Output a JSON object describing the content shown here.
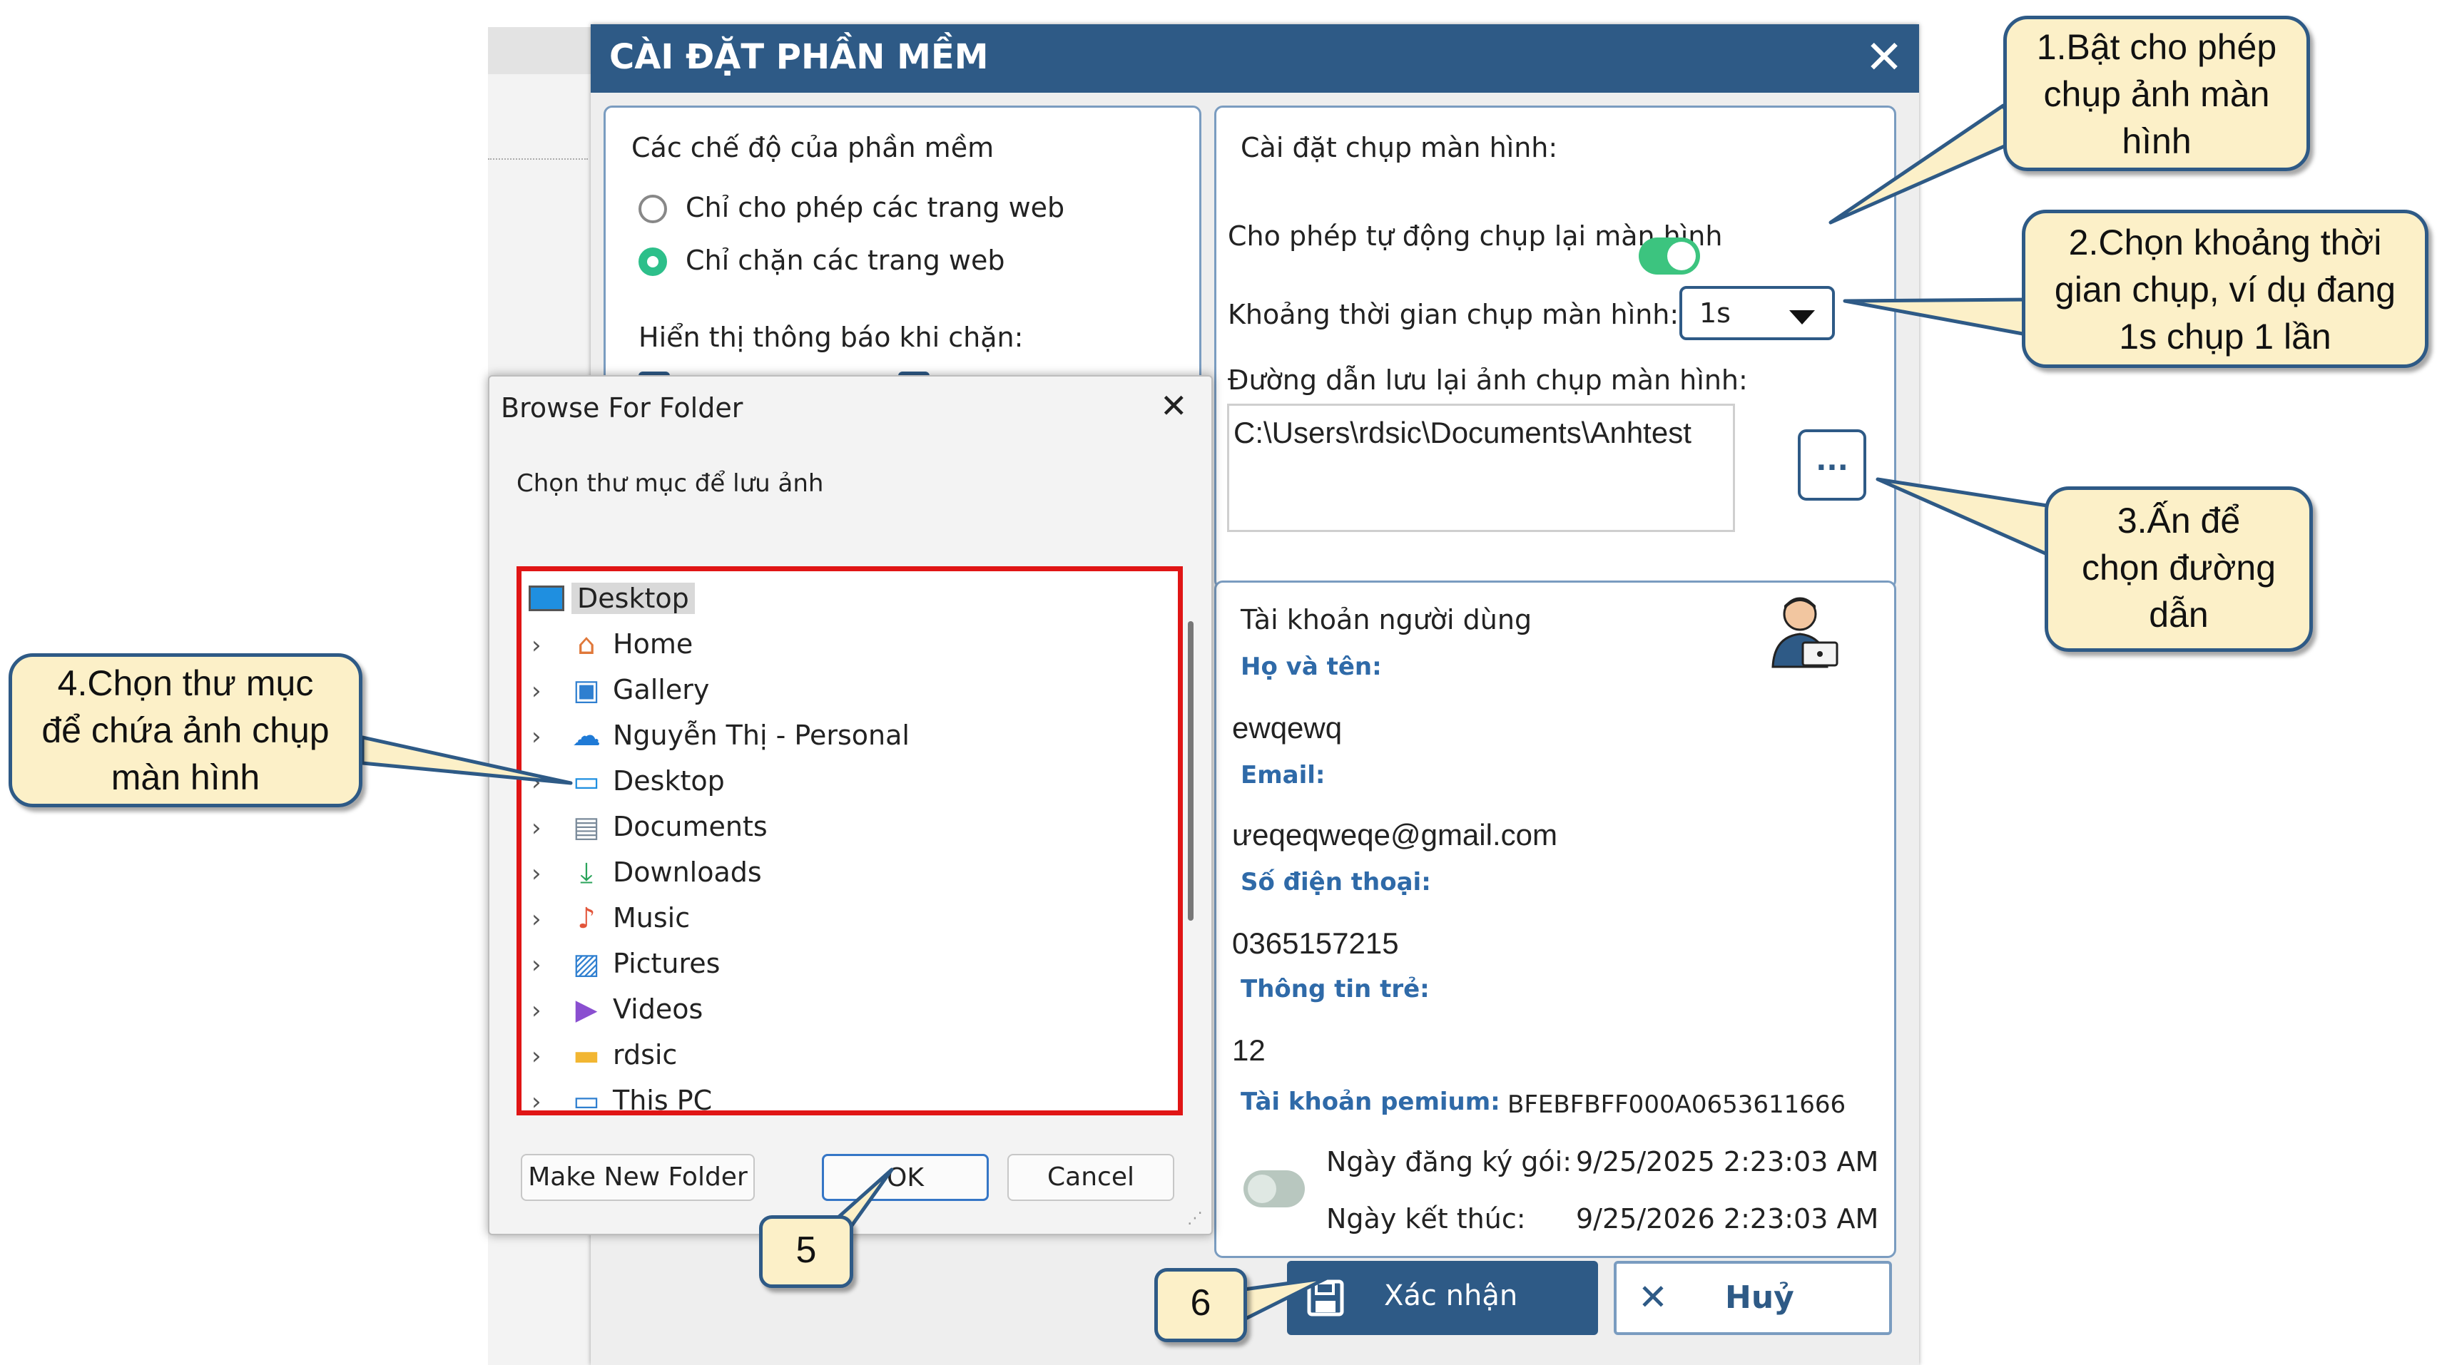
{
  "settings_dialog": {
    "title": "CÀI ĐẶT PHẦN MỀM",
    "close_glyph": "✕",
    "modes": {
      "heading": "Các chế độ của phần mềm",
      "options": [
        {
          "label": "Chỉ cho phép các trang web",
          "selected": false
        },
        {
          "label": "Chỉ chặn các trang web",
          "selected": true
        }
      ],
      "notify_heading": "Hiển thị thông báo khi chặn:"
    },
    "capture": {
      "heading": "Cài đặt chụp màn hình:",
      "auto_capture_label": "Cho phép tự động chụp lại màn hình",
      "auto_capture_enabled": true,
      "interval_label": "Khoảng thời gian chụp màn hình:",
      "interval_value": "1s",
      "path_label": "Đường dẫn lưu lại ảnh chụp màn hình:",
      "path_value": "C:\\Users\\rdsic\\Documents\\Anhtest",
      "browse_label": "..."
    },
    "account": {
      "heading": "Tài khoản người dùng",
      "avatar_icon": "user-laptop-icon",
      "name_label": "Họ và tên:",
      "name_value": "ewqewq",
      "email_label": "Email:",
      "email_value": "ưeqeqweqe@gmail.com",
      "phone_label": "Số điện thoại:",
      "phone_value": "0365157215",
      "child_label": "Thông tin trẻ:",
      "child_value": "12",
      "premium_label": "Tài khoản pemium:",
      "premium_value": "BFEBFBFF000A0653611666",
      "premium_enabled": false,
      "start_label": "Ngày đăng ký gói:",
      "start_value": "9/25/2025 2:23:03 AM",
      "end_label": "Ngày kết thúc:",
      "end_value": "9/25/2026 2:23:03 AM"
    },
    "buttons": {
      "confirm_label": "Xác nhận",
      "cancel_label": "Huỷ"
    }
  },
  "browse_dialog": {
    "title": "Browse For Folder",
    "close_glyph": "✕",
    "instruction": "Chọn thư mục để lưu ảnh",
    "root": "Desktop",
    "items": [
      {
        "label": "Home",
        "icon": "home-icon"
      },
      {
        "label": "Gallery",
        "icon": "gallery-icon"
      },
      {
        "label": "Nguyễn Thị - Personal",
        "icon": "onedrive-cloud-icon"
      },
      {
        "label": "Desktop",
        "icon": "desktop-folder-icon"
      },
      {
        "label": "Documents",
        "icon": "documents-icon"
      },
      {
        "label": "Downloads",
        "icon": "download-icon"
      },
      {
        "label": "Music",
        "icon": "music-icon"
      },
      {
        "label": "Pictures",
        "icon": "pictures-icon"
      },
      {
        "label": "Videos",
        "icon": "videos-icon"
      },
      {
        "label": "rdsic",
        "icon": "folder-icon"
      },
      {
        "label": "This PC",
        "icon": "this-pc-icon"
      }
    ],
    "buttons": {
      "new_folder": "Make New Folder",
      "ok": "OK",
      "cancel": "Cancel"
    }
  },
  "callouts": {
    "c1": [
      "1.Bật cho phép",
      "chụp ảnh màn",
      "hình"
    ],
    "c2": [
      "2.Chọn khoảng thời",
      "gian chụp, ví dụ đang",
      "1s chụp 1 lần"
    ],
    "c3": [
      "3.Ấn để",
      "chọn đường",
      "dẫn"
    ],
    "c4": [
      "4.Chọn thư mục",
      "để chứa ảnh chụp",
      "màn hình"
    ],
    "c5": "5",
    "c6": "6"
  },
  "colors": {
    "title_bar": "#2e5a86",
    "accent_green": "#3cc47f",
    "label_blue": "#2f6aa8",
    "callout_fill": "#fcf0c8",
    "callout_border": "#2e5a86",
    "highlight_red": "#e01515"
  }
}
